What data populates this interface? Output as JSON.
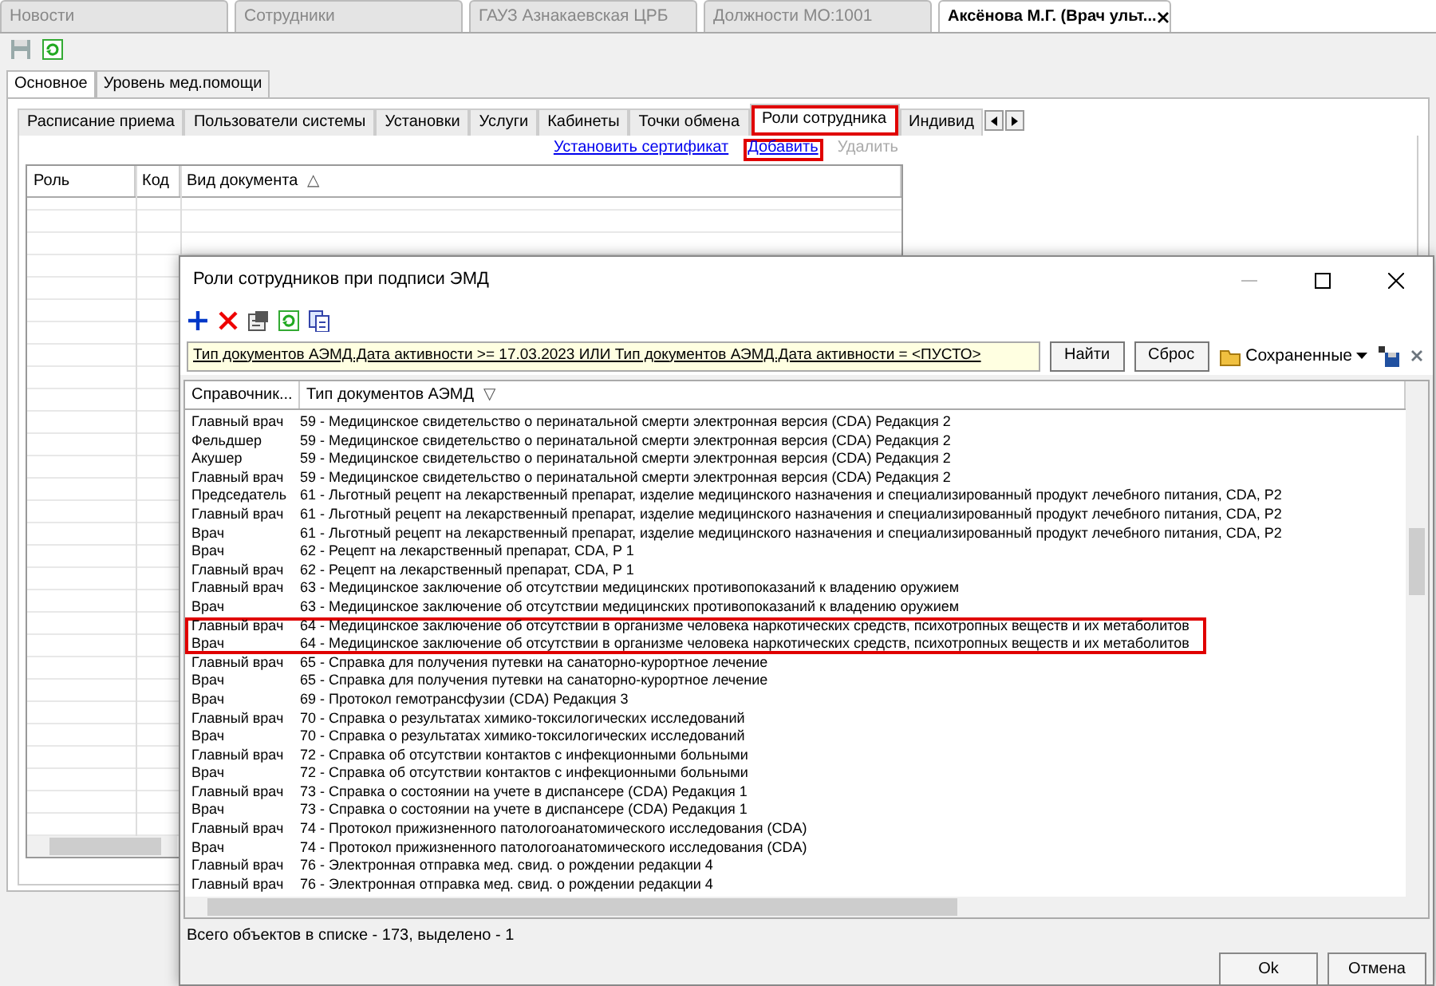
{
  "doc_tabs": [
    {
      "label": "Новости",
      "selected": false,
      "closable": false
    },
    {
      "label": "Сотрудники",
      "selected": false,
      "closable": false
    },
    {
      "label": "ГАУЗ Азнакаевская ЦРБ",
      "selected": false,
      "closable": false
    },
    {
      "label": "Должности МО:1001",
      "selected": false,
      "closable": false
    },
    {
      "label": "Аксёнова М.Г. (Врач ульт...",
      "selected": true,
      "closable": true
    }
  ],
  "section_tabs": [
    {
      "label": "Основное",
      "selected": true
    },
    {
      "label": "Уровень мед.помощи",
      "selected": false
    }
  ],
  "sub_tabs": [
    {
      "label": "Расписание приема",
      "selected": false,
      "highlighted": false
    },
    {
      "label": "Пользователи системы",
      "selected": false,
      "highlighted": false
    },
    {
      "label": "Установки",
      "selected": false,
      "highlighted": false
    },
    {
      "label": "Услуги",
      "selected": false,
      "highlighted": false
    },
    {
      "label": "Кабинеты",
      "selected": false,
      "highlighted": false
    },
    {
      "label": "Точки обмена",
      "selected": false,
      "highlighted": false
    },
    {
      "label": "Роли сотрудника",
      "selected": true,
      "highlighted": true
    },
    {
      "label": "Индивид",
      "selected": false,
      "highlighted": false
    }
  ],
  "actions": [
    {
      "label": "Установить сертификат",
      "disabled": false,
      "highlighted": false
    },
    {
      "label": "Добавить",
      "disabled": false,
      "highlighted": true
    },
    {
      "label": "Удалить",
      "disabled": true,
      "highlighted": false
    }
  ],
  "grid": {
    "columns": [
      {
        "label": "Роль"
      },
      {
        "label": "Код"
      },
      {
        "label": "Вид документа",
        "sort_icon": "△"
      }
    ]
  },
  "dialog": {
    "title": "Роли сотрудников при подписи ЭМД",
    "filter": "Тип документов АЭМД.Дата активности >= 17.03.2023 ИЛИ Тип документов АЭМД.Дата активности = <ПУСТО>",
    "filter_buttons": [
      "Найти",
      "Сброс"
    ],
    "saved": "Сохраненные",
    "columns": [
      {
        "label": "Справочник..."
      },
      {
        "label": "Тип документов АЭМД",
        "sort_icon": "▽"
      }
    ],
    "rows": [
      {
        "role": "Главный врач",
        "doc": "59 - Медицинское свидетельство о перинатальной смерти электронная версия  (CDA) Редакция 2",
        "highlighted": false
      },
      {
        "role": "Фельдшер",
        "doc": "59 - Медицинское свидетельство о перинатальной смерти электронная версия  (CDA) Редакция 2",
        "highlighted": false
      },
      {
        "role": "Акушер",
        "doc": "59 - Медицинское свидетельство о перинатальной смерти электронная версия  (CDA) Редакция 2",
        "highlighted": false
      },
      {
        "role": "Главный врач",
        "doc": "59 - Медицинское свидетельство о перинатальной смерти электронная версия  (CDA) Редакция 2",
        "highlighted": false
      },
      {
        "role": "Председатель",
        "doc": "61 - Льготный рецепт на лекарственный препарат, изделие медицинского назначения и специализированный продукт лечебного питания, CDA, P2",
        "highlighted": false
      },
      {
        "role": "Главный врач",
        "doc": "61 - Льготный рецепт на лекарственный препарат, изделие медицинского назначения и специализированный продукт лечебного питания, CDA, P2",
        "highlighted": false
      },
      {
        "role": "Врач",
        "doc": "61 - Льготный рецепт на лекарственный препарат, изделие медицинского назначения и специализированный продукт лечебного питания, CDA, P2",
        "highlighted": false
      },
      {
        "role": "Врач",
        "doc": "62 - Рецепт на лекарственный препарат, CDA, P 1",
        "highlighted": false
      },
      {
        "role": "Главный врач",
        "doc": "62 - Рецепт на лекарственный препарат, CDA, P 1",
        "highlighted": false
      },
      {
        "role": "Главный врач",
        "doc": "63 - Медицинское заключение об отсутствии медицинских противопоказаний к владению оружием",
        "highlighted": false
      },
      {
        "role": "Врач",
        "doc": "63 - Медицинское заключение об отсутствии медицинских противопоказаний к владению оружием",
        "highlighted": false
      },
      {
        "role": "Главный врач",
        "doc": "64 - Медицинское заключение об отсутствии в организме человека наркотических средств, психотропных веществ и их метаболитов",
        "highlighted": true
      },
      {
        "role": "Врач",
        "doc": "64 - Медицинское заключение об отсутствии в организме человека наркотических средств, психотропных веществ и их метаболитов",
        "highlighted": true
      },
      {
        "role": "Главный врач",
        "doc": "65 - Справка для получения путевки на санаторно-курортное лечение",
        "highlighted": false
      },
      {
        "role": "Врач",
        "doc": "65 - Справка для получения путевки на санаторно-курортное лечение",
        "highlighted": false
      },
      {
        "role": "Врач",
        "doc": "69 - Протокол гемотрансфузии (CDA) Редакция 3",
        "highlighted": false
      },
      {
        "role": "Главный врач",
        "doc": "70 - Справка о результатах химико-токсилогических исследований",
        "highlighted": false
      },
      {
        "role": "Врач",
        "doc": "70 - Справка о результатах химико-токсилогических исследований",
        "highlighted": false
      },
      {
        "role": "Главный врач",
        "doc": "72 - Справка об отсутствии контактов с инфекционными больными",
        "highlighted": false
      },
      {
        "role": "Врач",
        "doc": "72 - Справка об отсутствии контактов с инфекционными больными",
        "highlighted": false
      },
      {
        "role": "Главный врач",
        "doc": "73 - Справка о состоянии на учете в диспансере (CDA) Редакция 1",
        "highlighted": false
      },
      {
        "role": "Врач",
        "doc": "73 - Справка о состоянии на учете в диспансере (CDA) Редакция 1",
        "highlighted": false
      },
      {
        "role": "Главный врач",
        "doc": "74 - Протокол прижизненного патологоанатомического исследования (CDA)",
        "highlighted": false
      },
      {
        "role": "Врач",
        "doc": "74 - Протокол прижизненного патологоанатомического исследования (CDA)",
        "highlighted": false
      },
      {
        "role": "Главный врач",
        "doc": "76 - Электронная отправка мед. свид. о рождении редакции 4",
        "highlighted": false
      },
      {
        "role": "Главный врач",
        "doc": "76 - Электронная отправка мед. свид. о рождении редакции 4",
        "highlighted": false
      }
    ],
    "status": "Всего объектов в списке - 173, выделено - 1",
    "footer_buttons": [
      "Ok",
      "Отмена"
    ]
  }
}
